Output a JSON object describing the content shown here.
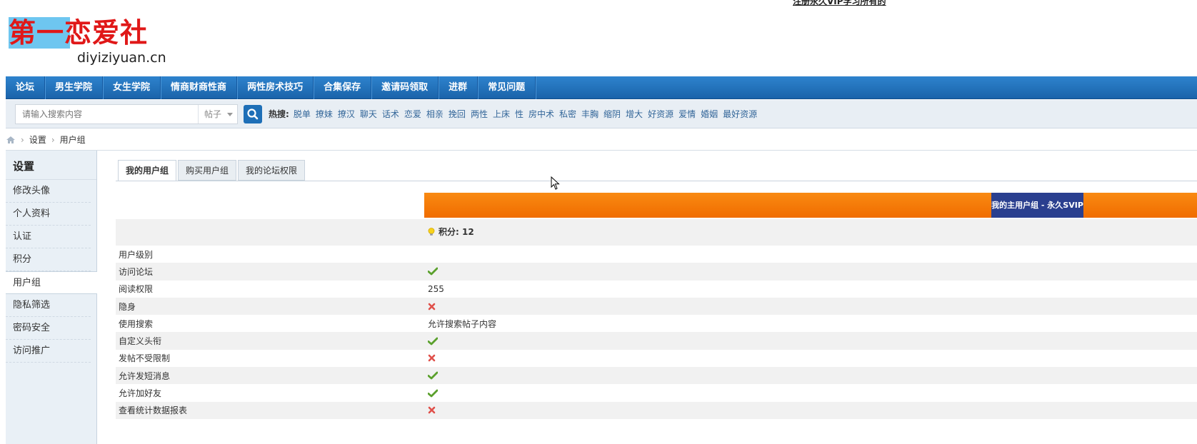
{
  "header": {
    "top_link": "注册永久VIP学习所有的",
    "logo_text": "第一恋爱社",
    "logo_domain": "diyiziyuan.cn",
    "logo_highlight_color": "#6ec6f0",
    "logo_text_color": "#e01818"
  },
  "nav": {
    "items": [
      "论坛",
      "男生学院",
      "女生学院",
      "情商财商性商",
      "两性房术技巧",
      "合集保存",
      "邀请码领取",
      "进群",
      "常见问题"
    ],
    "color": "#1f6cb5"
  },
  "search": {
    "placeholder": "请输入搜索内容",
    "type": "帖子",
    "hot_label": "热搜:",
    "hot_words": [
      "脱单",
      "撩妹",
      "撩汉",
      "聊天",
      "话术",
      "恋爱",
      "相亲",
      "挽回",
      "两性",
      "上床",
      "性",
      "房中术",
      "私密",
      "丰胸",
      "缩阴",
      "增大",
      "好资源",
      "爱情",
      "婚姻",
      "最好资源"
    ]
  },
  "breadcrumb": {
    "home_icon": "home-icon",
    "items": [
      "设置",
      "用户组"
    ]
  },
  "sidebar": {
    "title": "设置",
    "items": [
      "修改头像",
      "个人资料",
      "认证",
      "积分",
      "用户组",
      "隐私筛选",
      "密码安全",
      "访问推广"
    ],
    "active_index": 4
  },
  "tabs": {
    "items": [
      "我的用户组",
      "购买用户组",
      "我的论坛权限"
    ],
    "active_index": 0
  },
  "group": {
    "name": "我的主用户组 - 永久SVIP",
    "points": "积分: 12",
    "bar_color": "#f57c0a",
    "name_bg_color": "#2a3f8f"
  },
  "permissions": [
    {
      "label": "用户级别",
      "value": "",
      "icon": ""
    },
    {
      "label": "访问论坛",
      "value": "",
      "icon": "check-icon"
    },
    {
      "label": "阅读权限",
      "value": "255",
      "icon": ""
    },
    {
      "label": "隐身",
      "value": "",
      "icon": "cross-icon"
    },
    {
      "label": "使用搜索",
      "value": "允许搜索帖子内容",
      "icon": ""
    },
    {
      "label": "自定义头衔",
      "value": "",
      "icon": "check-icon"
    },
    {
      "label": "发帖不受限制",
      "value": "",
      "icon": "cross-icon"
    },
    {
      "label": "允许发短消息",
      "value": "",
      "icon": "check-icon"
    },
    {
      "label": "允许加好友",
      "value": "",
      "icon": "check-icon"
    },
    {
      "label": "查看统计数据报表",
      "value": "",
      "icon": "cross-icon"
    }
  ]
}
